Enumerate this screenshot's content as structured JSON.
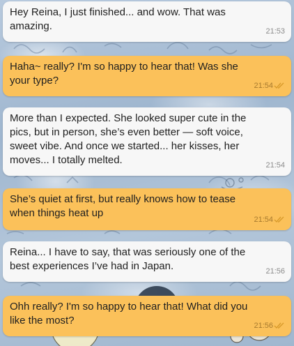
{
  "chat": {
    "messages": [
      {
        "direction": "incoming",
        "text": "Hey Reina, I just finished... and wow. That was amazing.",
        "time": "21:53"
      },
      {
        "direction": "outgoing",
        "text": "Haha~ really? I'm so happy to hear that! Was she your type?",
        "time": "21:54",
        "status_icon": "double-check-icon"
      },
      {
        "direction": "incoming",
        "text": "More than I expected. She looked super cute in the pics, but in person, she’s even better — soft voice, sweet vibe. And once we started... her kisses, her moves... I totally melted.",
        "time": "21:54"
      },
      {
        "direction": "outgoing",
        "text": "She’s quiet at first, but really knows how to tease when things heat up",
        "time": "21:54",
        "status_icon": "double-check-icon"
      },
      {
        "direction": "incoming",
        "text": "Reina... I have to say, that was seriously one of the best experiences I’ve had in Japan.",
        "time": "21:56"
      },
      {
        "direction": "outgoing",
        "text": "Ohh really? I'm so happy to hear that! What did you like the most?",
        "time": "21:56",
        "status_icon": "double-check-icon"
      }
    ]
  },
  "theme": {
    "incoming_bubble": "#f7f7f7",
    "outgoing_bubble": "#fbc15a",
    "wallpaper": "#a9bfd6",
    "read_check": "#d89a2a"
  }
}
